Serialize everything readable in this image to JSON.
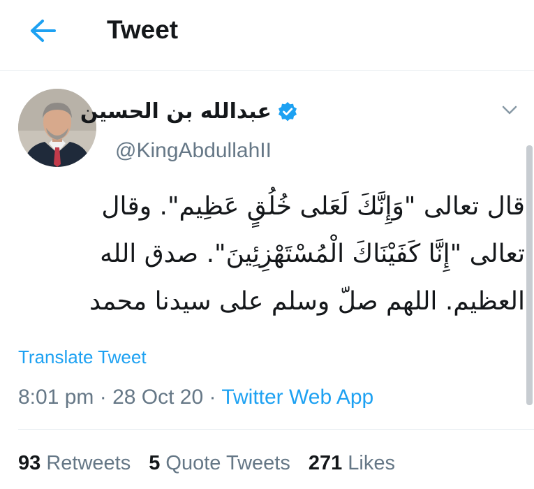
{
  "header": {
    "title": "Tweet",
    "back_icon": "arrow-left-icon"
  },
  "colors": {
    "accent": "#1da1f2",
    "text": "#14171a",
    "muted": "#657786",
    "border": "#e6ecf0"
  },
  "author": {
    "display_name": "عبدالله بن الحسين",
    "handle": "@KingAbdullahII",
    "verified": true
  },
  "tweet": {
    "lines": [
      "قال تعالى \"وَإِنَّكَ لَعَلى خُلُقٍ عَظِيم\". وقال",
      "تعالى \"إِنَّا كَفَيْنَاكَ الْمُسْتَهْزِئِينَ\". صدق الله",
      "العظيم. اللهم صلّ وسلم على سيدنا محمد"
    ],
    "translate_label": "Translate Tweet",
    "time": "8:01 pm",
    "date": "28 Oct 20",
    "separator": "·",
    "source": "Twitter Web App"
  },
  "stats": {
    "retweets_count": "93",
    "retweets_label": "Retweets",
    "quotes_count": "5",
    "quotes_label": "Quote Tweets",
    "likes_count": "271",
    "likes_label": "Likes"
  }
}
